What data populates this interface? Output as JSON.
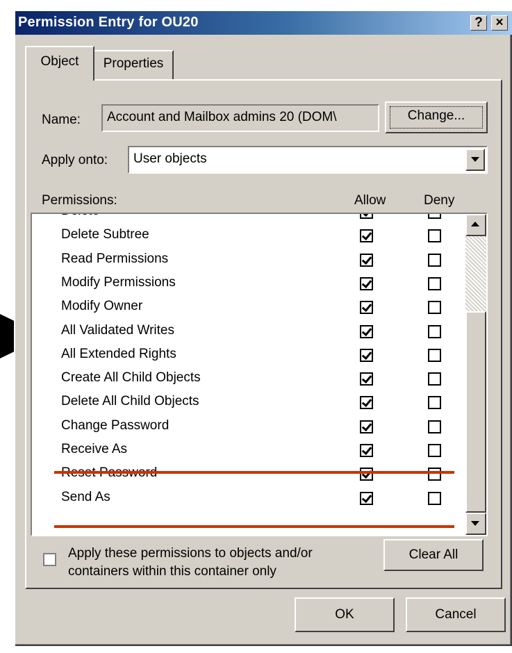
{
  "window": {
    "title": "Permission Entry for OU20",
    "help_btn": "?",
    "close_btn": "×"
  },
  "tabs": [
    {
      "label": "Object"
    },
    {
      "label": "Properties"
    }
  ],
  "name_row": {
    "label": "Name:",
    "value": "Account and Mailbox admins 20 (DOM\\",
    "change_btn": "Change..."
  },
  "apply_row": {
    "label": "Apply onto:",
    "value": "User objects"
  },
  "permissions": {
    "label": "Permissions:",
    "allow_header": "Allow",
    "deny_header": "Deny",
    "rows": [
      {
        "name": "Delete",
        "allow": true,
        "deny": false
      },
      {
        "name": "Delete Subtree",
        "allow": true,
        "deny": false
      },
      {
        "name": "Read Permissions",
        "allow": true,
        "deny": false
      },
      {
        "name": "Modify Permissions",
        "allow": true,
        "deny": false
      },
      {
        "name": "Modify Owner",
        "allow": true,
        "deny": false
      },
      {
        "name": "All Validated Writes",
        "allow": true,
        "deny": false
      },
      {
        "name": "All Extended Rights",
        "allow": true,
        "deny": false
      },
      {
        "name": "Create All Child Objects",
        "allow": true,
        "deny": false
      },
      {
        "name": "Delete All Child Objects",
        "allow": true,
        "deny": false
      },
      {
        "name": "Change Password",
        "allow": true,
        "deny": false
      },
      {
        "name": "Receive As",
        "allow": true,
        "deny": false
      },
      {
        "name": "Reset Password",
        "allow": true,
        "deny": false
      },
      {
        "name": "Send As",
        "allow": true,
        "deny": false
      }
    ]
  },
  "apply_checkbox": {
    "line1": "Apply these permissions to objects and/or",
    "line2": "containers within this container only",
    "checked": false
  },
  "clear_all_btn": "Clear All",
  "ok_btn": "OK",
  "cancel_btn": "Cancel",
  "colors": {
    "title_start": "#0a246a",
    "dialog_bg": "#d4d0c8",
    "annotation_red": "#cc3300"
  }
}
